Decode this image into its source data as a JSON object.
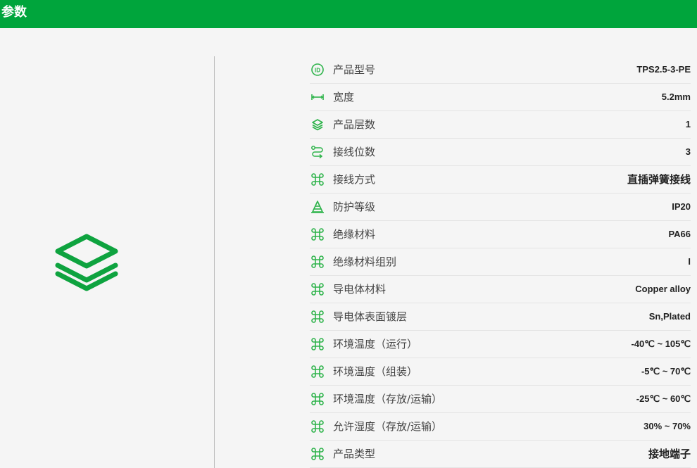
{
  "header": {
    "title": "参数"
  },
  "colors": {
    "brand": "#00a53c",
    "icon": "#2db34a"
  },
  "hero": {
    "icon": "layers-icon"
  },
  "params": [
    {
      "label": "产品型号",
      "value": "TPS2.5-3-PE",
      "icon": "id-icon"
    },
    {
      "label": "宽度",
      "value": "5.2mm",
      "icon": "width-icon"
    },
    {
      "label": "产品层数",
      "value": "1",
      "icon": "layers-icon"
    },
    {
      "label": "接线位数",
      "value": "3",
      "icon": "route-icon"
    },
    {
      "label": "接线方式",
      "value": "直插弹簧接线",
      "icon": "command-icon"
    },
    {
      "label": "防护等级",
      "value": "IP20",
      "icon": "cone-icon"
    },
    {
      "label": "绝缘材料",
      "value": "PA66",
      "icon": "command-icon"
    },
    {
      "label": "绝缘材料组别",
      "value": "I",
      "icon": "command-icon"
    },
    {
      "label": "导电体材料",
      "value": "Copper alloy",
      "icon": "command-icon"
    },
    {
      "label": "导电体表面镀层",
      "value": "Sn,Plated",
      "icon": "command-icon"
    },
    {
      "label": "环境温度（运行）",
      "value": "-40℃ ~ 105℃",
      "icon": "command-icon"
    },
    {
      "label": "环境温度（组装）",
      "value": "-5℃ ~ 70℃",
      "icon": "command-icon"
    },
    {
      "label": "环境温度（存放/运输）",
      "value": "-25℃ ~ 60℃",
      "icon": "command-icon"
    },
    {
      "label": "允许湿度（存放/运输）",
      "value": "30% ~ 70%",
      "icon": "command-icon"
    },
    {
      "label": "产品类型",
      "value": "接地端子",
      "icon": "command-icon"
    }
  ]
}
